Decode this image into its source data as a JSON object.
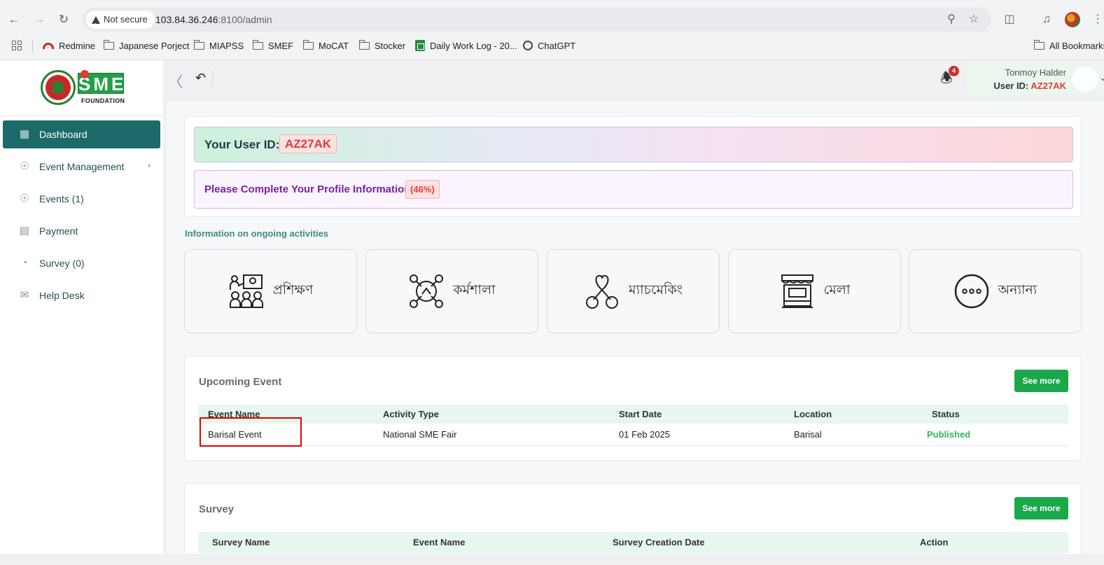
{
  "browser": {
    "security_label": "Not secure",
    "url_host": "103.84.36.246",
    "url_rest": ":8100/admin",
    "bookmarks": [
      {
        "label": "Redmine",
        "icon": "redmine-icon"
      },
      {
        "label": "Japanese Porject",
        "icon": "folder-icon"
      },
      {
        "label": "MIAPSS",
        "icon": "folder-icon"
      },
      {
        "label": "SMEF",
        "icon": "folder-icon"
      },
      {
        "label": "MoCAT",
        "icon": "folder-icon"
      },
      {
        "label": "Stocker",
        "icon": "folder-icon"
      },
      {
        "label": "Daily Work Log - 20...",
        "icon": "sheets-icon"
      },
      {
        "label": "ChatGPT",
        "icon": "chatgpt-icon"
      },
      {
        "label": "All Bookmarks",
        "icon": "folder-icon"
      }
    ]
  },
  "brand": {
    "logo_text": "SME",
    "logo_subtext": "FOUNDATION"
  },
  "sidebar": {
    "items": [
      {
        "label": "Dashboard",
        "icon": "dashboard-grid-icon",
        "active": true
      },
      {
        "label": "Event Management",
        "icon": "lock-icon",
        "has_submenu": true
      },
      {
        "label": "Events (1)",
        "icon": "lock-icon"
      },
      {
        "label": "Payment",
        "icon": "payment-icon"
      },
      {
        "label": "Survey (0)",
        "icon": "pie-chart-icon"
      },
      {
        "label": "Help Desk",
        "icon": "mail-icon"
      }
    ]
  },
  "header": {
    "notification_count": "4",
    "user_name": "Tonmoy Halder",
    "user_id_label": "User ID:",
    "user_id": "AZ27AK"
  },
  "dashboard": {
    "user_id_label": "Your User ID:",
    "user_id": "AZ27AK",
    "profile_message": "Please Complete Your Profile Information",
    "profile_percent": "(46%)",
    "activities_caption": "Information on ongoing activities",
    "activities": [
      {
        "label": "প্রশিক্ষণ",
        "icon": "training-icon"
      },
      {
        "label": "কর্মশালা",
        "icon": "workshop-icon"
      },
      {
        "label": "ম্যাচমেকিং",
        "icon": "matchmaking-icon"
      },
      {
        "label": "মেলা",
        "icon": "fair-stall-icon"
      },
      {
        "label": "অন্যান্য",
        "icon": "more-icon"
      }
    ]
  },
  "upcoming_event": {
    "title": "Upcoming Event",
    "see_more": "See more",
    "columns": [
      "Event Name",
      "Activity Type",
      "Start Date",
      "Location",
      "Status"
    ],
    "rows": [
      {
        "event_name": "Barisal Event",
        "activity_type": "National SME Fair",
        "start_date": "01 Feb 2025",
        "location": "Barisal",
        "status": "Published"
      }
    ]
  },
  "survey": {
    "title": "Survey",
    "see_more": "See more",
    "columns": [
      "Survey Name",
      "Event Name",
      "Survey Creation Date",
      "Action"
    ]
  }
}
